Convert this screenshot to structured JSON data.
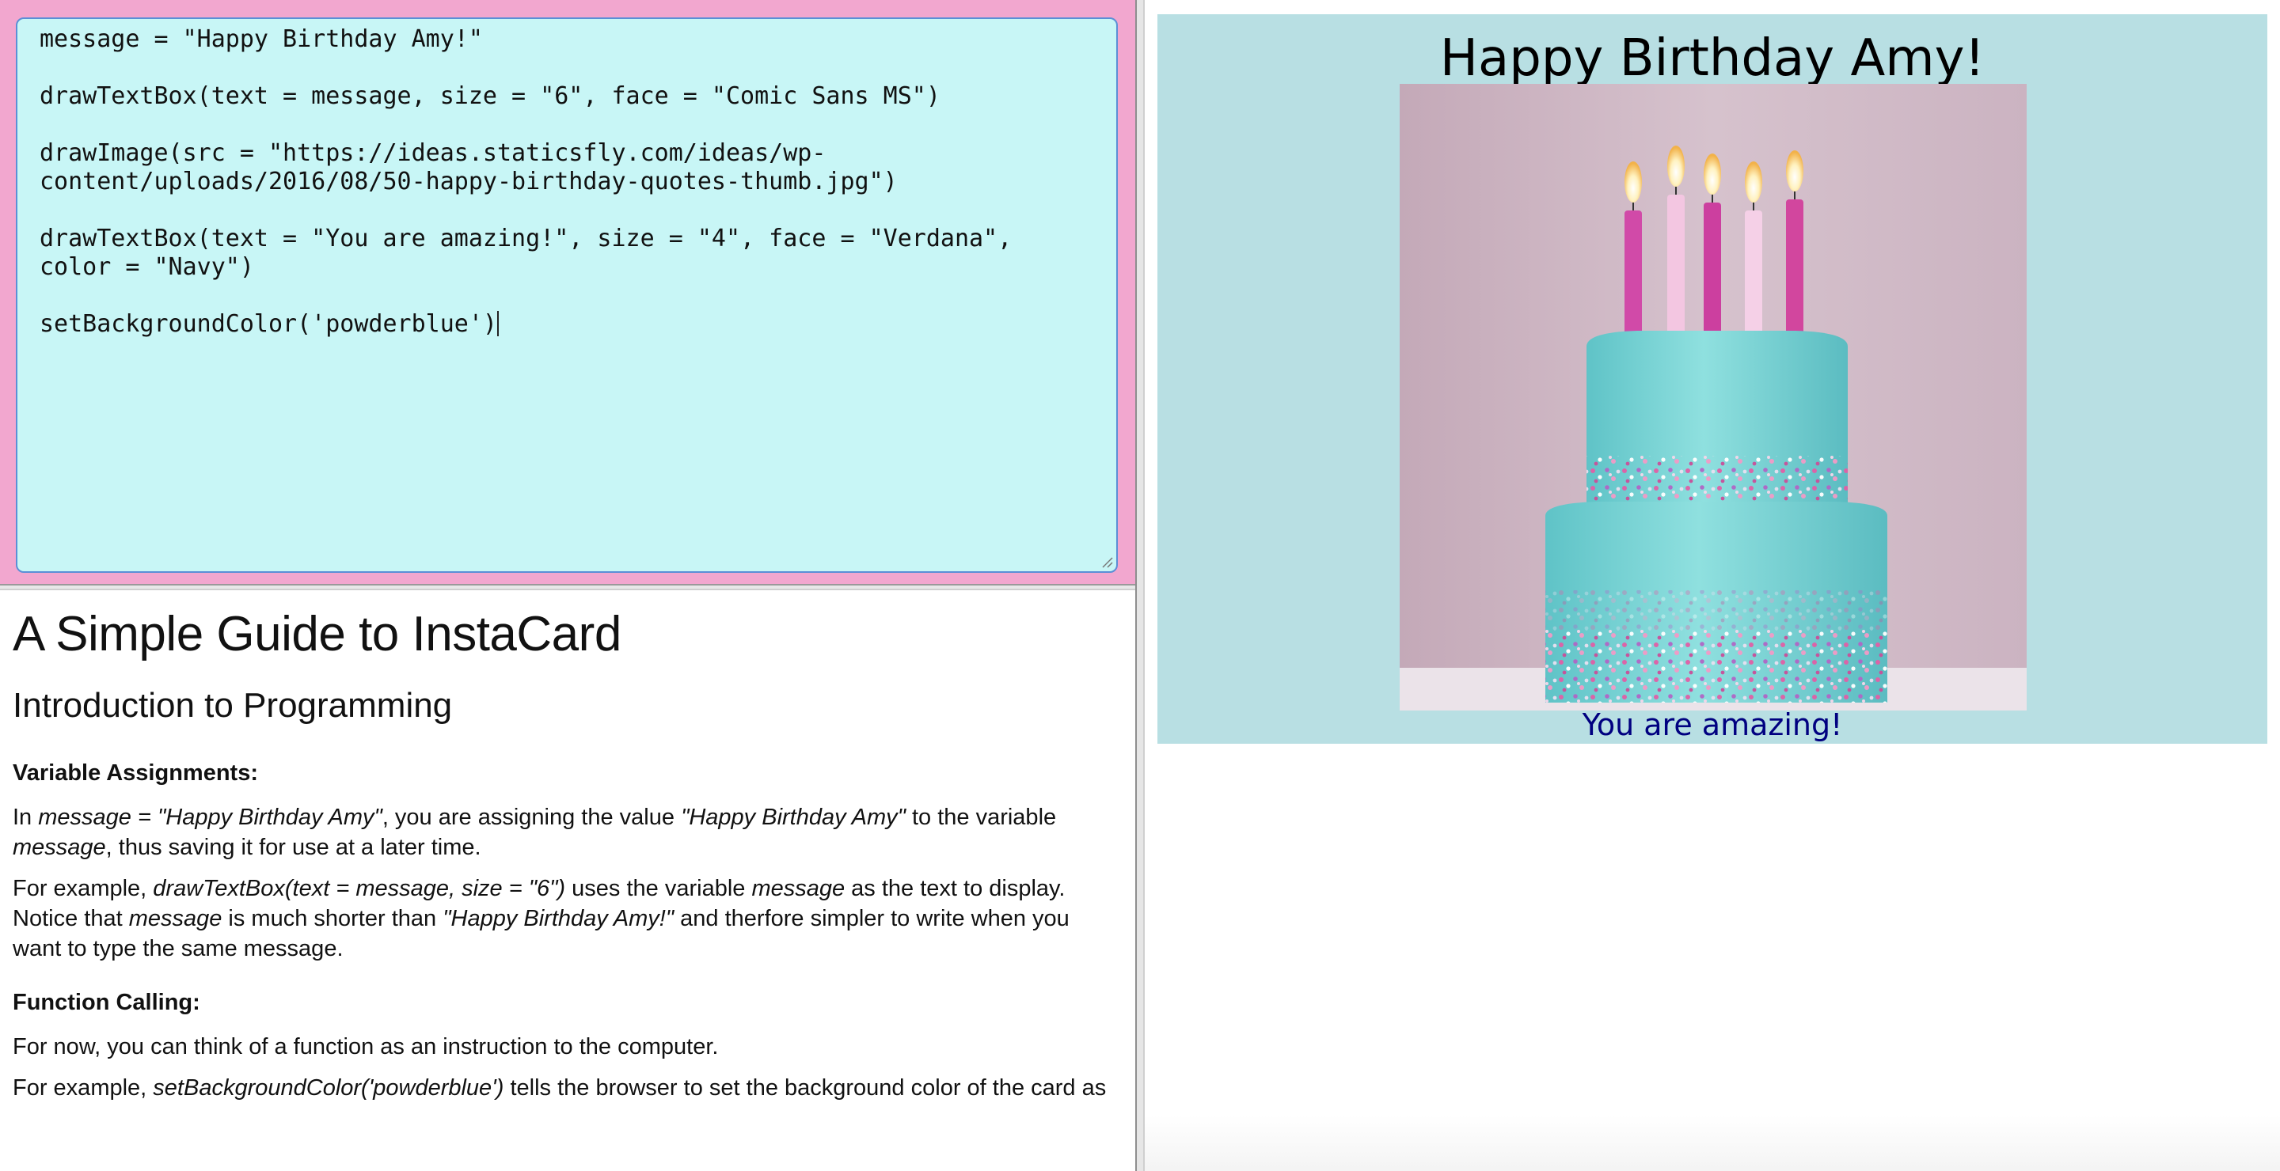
{
  "editor": {
    "line1": "message = \"Happy Birthday Amy!\"",
    "line2": "drawTextBox(text = message, size = \"6\", face = \"Comic Sans MS\")",
    "line3": "drawImage(src = \"https://ideas.staticsfly.com/ideas/wp-content/uploads/2016/08/50-happy-birthday-quotes-thumb.jpg\")",
    "line4": "drawTextBox(text = \"You are amazing!\", size = \"4\", face = \"Verdana\", color = \"Navy\")",
    "line5": "setBackgroundColor('powderblue')"
  },
  "guide": {
    "title": "A Simple Guide to InstaCard",
    "subtitle": "Introduction to Programming",
    "section1_heading": "Variable Assignments:",
    "p1": {
      "t1": "In ",
      "i1": "message = \"Happy Birthday Amy\"",
      "t2": ", you are assigning the value ",
      "i2": "\"Happy Birthday Amy\"",
      "t3": " to the variable ",
      "i3": "message",
      "t4": ", thus saving it for use at a later time."
    },
    "p2": {
      "t1": "For example, ",
      "i1": "drawTextBox(text = message, size = \"6\")",
      "t2": " uses the variable ",
      "i2": "message",
      "t3": " as the text to display. Notice that ",
      "i3": "message",
      "t4": " is much shorter than ",
      "i4": "\"Happy Birthday Amy!\"",
      "t5": " and therfore simpler to write when you want to type the same message."
    },
    "section2_heading": "Function Calling:",
    "p3": "For now, you can think of a function as an instruction to the computer.",
    "p4": {
      "t1": "For example, ",
      "i1": "setBackgroundColor('powderblue')",
      "t2": " tells the browser to set the background color of the card as"
    }
  },
  "card": {
    "title": "Happy Birthday Amy!",
    "subtitle": "You are amazing!",
    "background_color": "#b8dfe3",
    "image_icon": "birthday-cake-image"
  },
  "colors": {
    "editor_frame": "#f2a7cf",
    "editor_bg": "#c8f6f6",
    "subtitle_text": "#000080"
  }
}
